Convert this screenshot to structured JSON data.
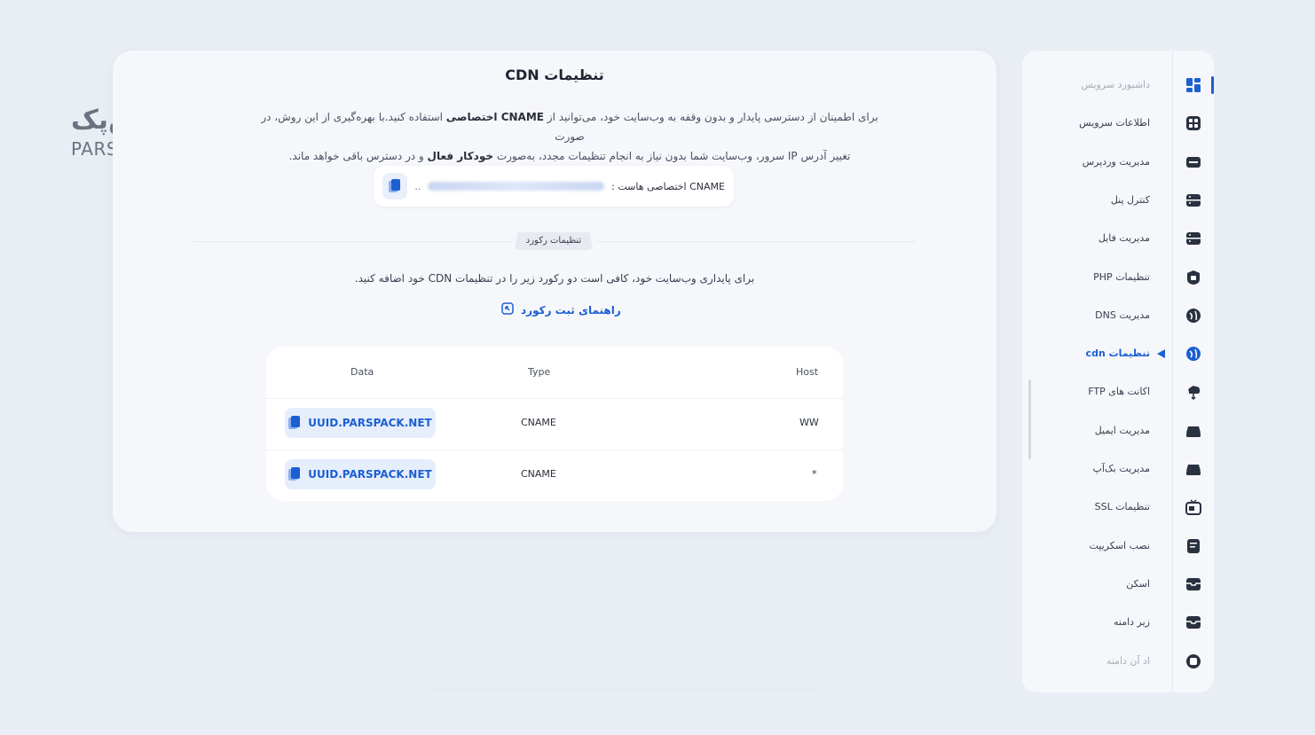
{
  "page": {
    "title": "تنظیمات CDN",
    "intro_line1_part1": "برای اطمینان از دسترسی پایدار و بدون وقفه به وب‌سایت خود، می‌توانید از ",
    "intro_line1_bold": "CNAME اختصاصی",
    "intro_line1_part2": " استفاده کنید.با بهره‌گیری از این روش، در صورت",
    "intro_line2_part1": "تغییر آدرس IP سرور، وب‌سایت شما بدون نیاز به انجام تنظیمات مجدد، به‌صورت ",
    "intro_line2_bold": "خودکار فعال",
    "intro_line2_part2": " و در دسترس باقی خواهد ماند.",
    "cname_label": "CNAME اختصاصی هاست :",
    "cname_ellipsis": "..",
    "section_label": "تنظیمات رکورد",
    "record_instruction": "برای پایداری وب‌سایت خود، کافی است دو رکورد زیر را در تنظیمات CDN خود اضافه کنید.",
    "guide_link": "راهنمای ثبت رکورد"
  },
  "table": {
    "headers": {
      "host": "Host",
      "type": "Type",
      "data": "Data"
    },
    "rows": [
      {
        "host": "WW",
        "type": "CNAME",
        "data": "UUID.PARSPACK.NET"
      },
      {
        "host": "*",
        "type": "CNAME",
        "data": "UUID.PARSPACK.NET"
      }
    ]
  },
  "logo": {
    "fa": "پارس‌پک",
    "en": "PARS PACK"
  },
  "sidebar": {
    "items": [
      {
        "label": "داشبورد سرویس",
        "icon": "dashboard-icon",
        "state": "faded"
      },
      {
        "label": "اطلاعات سرویس",
        "icon": "service-info-icon",
        "state": "normal"
      },
      {
        "label": "مدیریت وردپرس",
        "icon": "wordpress-icon",
        "state": "normal"
      },
      {
        "label": "کنترل پنل",
        "icon": "control-panel-icon",
        "state": "normal"
      },
      {
        "label": "مدیریت فایل",
        "icon": "file-manager-icon",
        "state": "normal"
      },
      {
        "label": "تنظیمات PHP",
        "icon": "php-icon",
        "state": "normal"
      },
      {
        "label": "مدیریت DNS",
        "icon": "dns-icon",
        "state": "normal"
      },
      {
        "label": "تنظیمات cdn",
        "icon": "cdn-icon",
        "state": "active"
      },
      {
        "label": "اکانت های FTP",
        "icon": "ftp-icon",
        "state": "normal"
      },
      {
        "label": "مدیریت ایمیل",
        "icon": "email-icon",
        "state": "normal"
      },
      {
        "label": "مدیریت بک‌آپ",
        "icon": "backup-icon",
        "state": "normal"
      },
      {
        "label": "تنظیمات SSL",
        "icon": "ssl-icon",
        "state": "normal"
      },
      {
        "label": "نصب اسکریپت",
        "icon": "script-icon",
        "state": "normal"
      },
      {
        "label": "اسکن",
        "icon": "scan-icon",
        "state": "normal"
      },
      {
        "label": "زیر دامنه",
        "icon": "subdomain-icon",
        "state": "normal"
      },
      {
        "label": "اد آن دامنه",
        "icon": "addon-domain-icon",
        "state": "faded"
      }
    ]
  },
  "colors": {
    "accent": "#1c5fd1",
    "background": "#e9edf4",
    "card": "#f5f7fb"
  }
}
